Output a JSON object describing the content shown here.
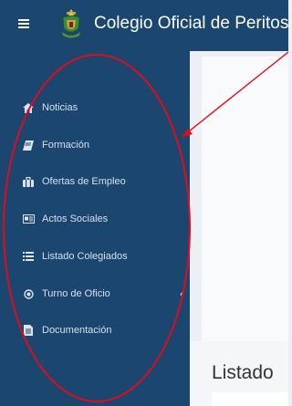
{
  "header": {
    "title": "Colegio Oficial de Peritos",
    "menu_icon": "hamburger-icon",
    "logo": "crest-logo"
  },
  "sidebar": {
    "items": [
      {
        "label": "Noticias",
        "icon": "home-icon"
      },
      {
        "label": "Formación",
        "icon": "book-icon"
      },
      {
        "label": "Ofertas de Empleo",
        "icon": "briefcase-icon"
      },
      {
        "label": "Actos Sociales",
        "icon": "newspaper-icon"
      },
      {
        "label": "Listado Colegiados",
        "icon": "list-icon"
      },
      {
        "label": "Turno de Oficio",
        "icon": "circle-dot-icon",
        "chevron": "‹"
      },
      {
        "label": "Documentación",
        "icon": "document-icon"
      }
    ]
  },
  "main": {
    "heading": "Listado"
  },
  "colors": {
    "navy": "#1b466f",
    "annotation": "#e10b1a"
  }
}
